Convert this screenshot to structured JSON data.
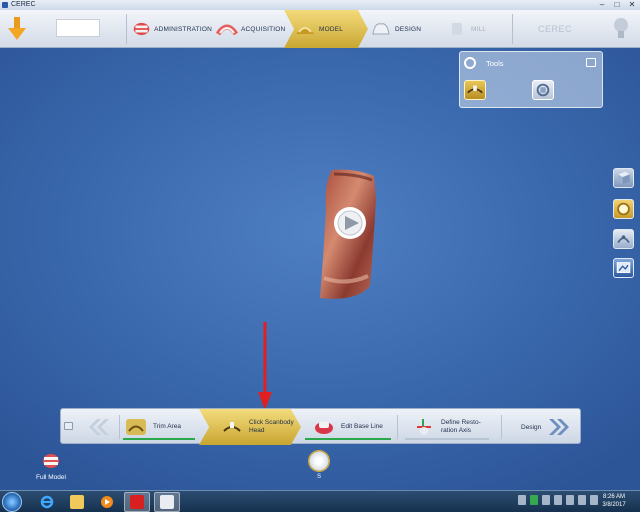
{
  "window": {
    "title": "CEREC",
    "controls": [
      "–",
      "□",
      "✕"
    ]
  },
  "topnav": {
    "tabs": [
      {
        "label": "ADMINISTRATION"
      },
      {
        "label": "ACQUISITION"
      },
      {
        "label": "MODEL"
      },
      {
        "label": "DESIGN"
      },
      {
        "label": "MILL"
      }
    ],
    "active_tab": "MODEL",
    "brand": "CEREC",
    "patient_field": ""
  },
  "tools_panel": {
    "title": "Tools"
  },
  "workflow": {
    "steps": [
      {
        "label": "Trim Area",
        "progress": 1.0
      },
      {
        "label_line1": "Click Scanbody",
        "label_line2": "Head"
      },
      {
        "label": "Edit Base Line",
        "progress": 1.0
      },
      {
        "label_line1": "Define Resto-",
        "label_line2": "ration Axis"
      }
    ],
    "active_step": "Click Scanbody Head",
    "next_label": "Design"
  },
  "full_model": {
    "label": "Full Model"
  },
  "shade": {
    "label": "S"
  },
  "taskbar": {
    "apps": [
      "start",
      "internet-explorer",
      "file-explorer",
      "media-player",
      "acrobat",
      "cerec"
    ],
    "clock_time": "8:26 AM",
    "clock_date": "3/8/2017"
  },
  "colors": {
    "accent_gold": "#d9b94a",
    "progress_green": "#2aa84a",
    "annotation_red": "#e02020",
    "background_blue": "#3a68ad"
  }
}
